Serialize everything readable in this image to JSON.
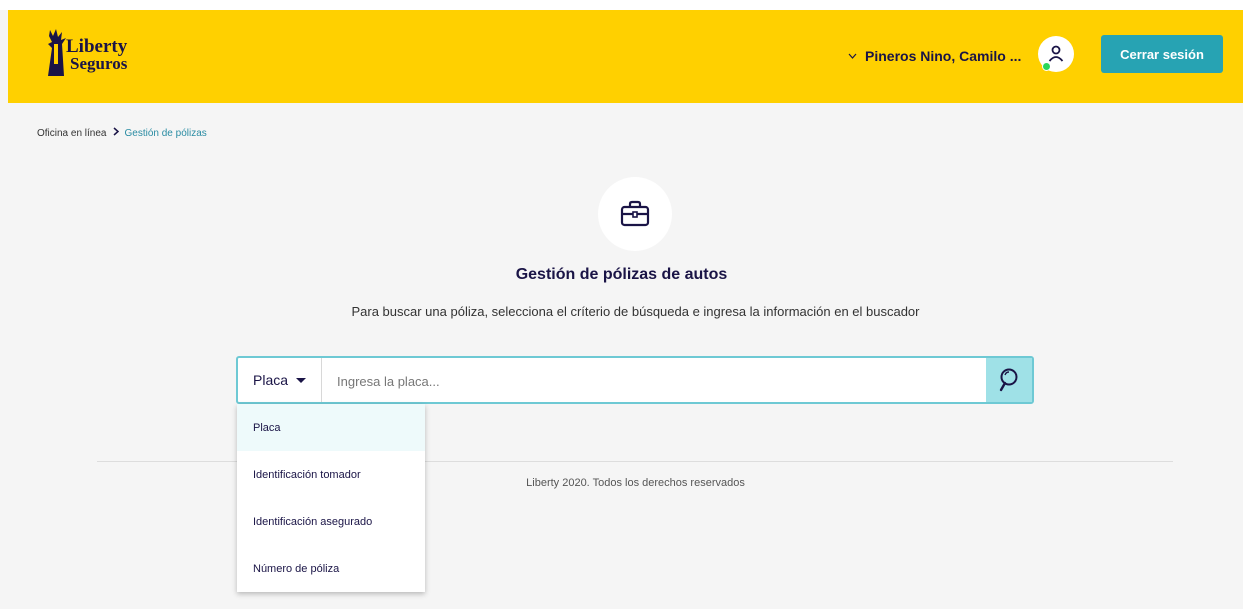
{
  "header": {
    "logo": {
      "line1": "Liberty",
      "line2": "Seguros"
    },
    "user_name": "Pineros Nino, Camilo ...",
    "logout_label": "Cerrar sesión"
  },
  "breadcrumb": {
    "items": [
      "Oficina en línea",
      "Gestión de pólizas"
    ]
  },
  "main": {
    "title": "Gestión de pólizas de autos",
    "subtitle": "Para buscar una póliza, selecciona el críterio de búsqueda e ingresa la información en el buscador",
    "search": {
      "selected_criterion": "Placa",
      "placeholder": "Ingresa la placa...",
      "options": [
        "Placa",
        "Identificación tomador",
        "Identificación asegurado",
        "Número de póliza"
      ]
    }
  },
  "footer": {
    "text": "Liberty 2020. Todos los derechos reservados"
  },
  "colors": {
    "header_bg": "#ffd000",
    "accent": "#27a3b3",
    "navy": "#1a1446",
    "search_border": "#6ec9d4",
    "online_dot": "#2bd65c"
  },
  "icons": [
    "liberty-statue-logo",
    "chevron-down-icon",
    "user-icon",
    "chevron-right-icon",
    "briefcase-icon",
    "caret-down-icon",
    "search-icon"
  ]
}
